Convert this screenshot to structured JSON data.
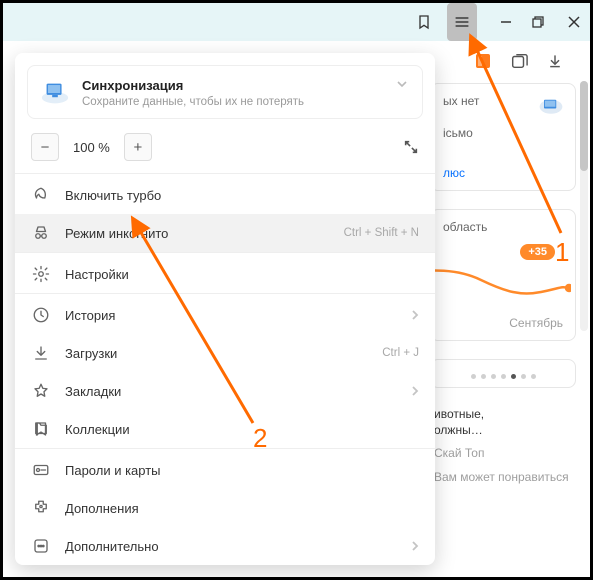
{
  "titlebar": {
    "bookmark_icon": "bookmark-outline",
    "menu_icon": "hamburger"
  },
  "toolbar_icons": {
    "ext": "extension",
    "tabs": "tabs",
    "download": "download"
  },
  "menu": {
    "sync": {
      "title": "Синхронизация",
      "subtitle": "Сохраните данные, чтобы их не потерять"
    },
    "zoom": {
      "minus": "−",
      "value": "100 %",
      "plus": "+"
    },
    "items": [
      {
        "id": "turbo",
        "label": "Включить турбо",
        "shortcut": "",
        "chevron": false,
        "selected": false
      },
      {
        "id": "incognito",
        "label": "Режим инкогнито",
        "shortcut": "Ctrl + Shift + N",
        "chevron": false,
        "selected": true
      },
      {
        "id": "settings",
        "label": "Настройки",
        "shortcut": "",
        "chevron": false,
        "selected": false
      },
      {
        "id": "history",
        "label": "История",
        "shortcut": "",
        "chevron": true,
        "selected": false
      },
      {
        "id": "downloads",
        "label": "Загрузки",
        "shortcut": "Ctrl + J",
        "chevron": false,
        "selected": false
      },
      {
        "id": "bookmarks",
        "label": "Закладки",
        "shortcut": "",
        "chevron": true,
        "selected": false
      },
      {
        "id": "collections",
        "label": "Коллекции",
        "shortcut": "",
        "chevron": false,
        "selected": false
      },
      {
        "id": "passwords",
        "label": "Пароли и карты",
        "shortcut": "",
        "chevron": false,
        "selected": false
      },
      {
        "id": "addons",
        "label": "Дополнения",
        "shortcut": "",
        "chevron": false,
        "selected": false
      },
      {
        "id": "more",
        "label": "Дополнительно",
        "shortcut": "",
        "chevron": true,
        "selected": false
      }
    ]
  },
  "widgets": {
    "mail": {
      "line1": "ых нет",
      "line2": "ісьмо",
      "link": "люс"
    },
    "weather": {
      "region": "область",
      "badge": "+35",
      "month": "Сентябрь"
    },
    "rec": {
      "title1": "ивотные,",
      "title2": "олжны…",
      "source": "Скай Топ",
      "footer": "Вам может понравиться"
    }
  },
  "annotations": {
    "n1": "1",
    "n2": "2"
  }
}
